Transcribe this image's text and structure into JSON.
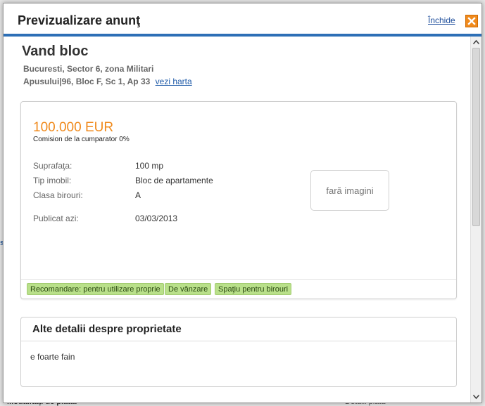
{
  "background": {
    "snippet_left": "s",
    "snippet_bottom": "Modalități de plata:",
    "snippet_right": "Detalii plata"
  },
  "modal": {
    "title": "Previzualizare anunţ",
    "close_link": "Închide"
  },
  "listing": {
    "title": "Vand bloc",
    "address_line1": "Bucuresti, Sector 6, zona Militari",
    "address_line2": "Apusului|96, Bloc F, Sc 1, Ap 33",
    "map_link": "vezi harta",
    "price": "100.000 EUR",
    "commission": "Comision de la cumparator 0%",
    "specs": [
      {
        "label": "Suprafaţa:",
        "value": "100 mp"
      },
      {
        "label": "Tip imobil:",
        "value": "Bloc de apartamente"
      },
      {
        "label": "Clasa birouri:",
        "value": "A"
      },
      {
        "label": "Publicat azi:",
        "value": "03/03/2013"
      }
    ],
    "no_image": "fară imagini",
    "tags": [
      "Recomandare: pentru utilizare proprie",
      "De vânzare",
      "Spaţiu pentru birouri"
    ]
  },
  "details": {
    "title": "Alte detalii despre proprietate",
    "text": "e foarte fain"
  },
  "colors": {
    "accent_blue": "#2d6fb6",
    "price_orange": "#f08a1c",
    "tag_green": "#b9e08a",
    "link_blue": "#1e5aa8"
  }
}
